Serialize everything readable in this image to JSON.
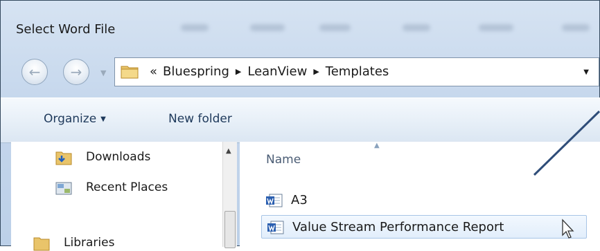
{
  "window": {
    "title": "Select Word File"
  },
  "nav": {
    "back_icon": "arrow-left-icon",
    "forward_icon": "arrow-right-icon",
    "breadcrumb_prefix": "«",
    "breadcrumbs": [
      "Bluespring",
      "LeanView",
      "Templates"
    ]
  },
  "toolbar": {
    "organize_label": "Organize",
    "new_folder_label": "New folder"
  },
  "sidebar": {
    "items": [
      {
        "label": "Downloads",
        "icon": "downloads-folder-icon"
      },
      {
        "label": "Recent Places",
        "icon": "recent-places-icon"
      },
      {
        "label": "Libraries",
        "icon": "libraries-icon"
      }
    ]
  },
  "file_list": {
    "column_header": "Name",
    "files": [
      {
        "name": "A3",
        "icon": "word-document-icon"
      },
      {
        "name": "Value Stream Performance Report",
        "icon": "word-document-icon",
        "selected": true
      }
    ]
  },
  "colors": {
    "accent": "#2f4d79",
    "frame": "#c4d6ec",
    "selection": "#e2eefb"
  }
}
